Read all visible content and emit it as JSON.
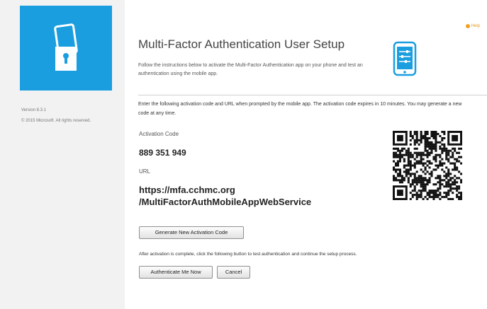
{
  "sidebar": {
    "logo_icon": "lock-phone-icon",
    "version": "Version 8.3.1",
    "copyright": "© 2015 Microsoft. All rights reserved.",
    "tile_color": "#1a9ee0"
  },
  "header": {
    "help": "Help",
    "help_icon": "help-icon",
    "title": "Multi-Factor Authentication User Setup",
    "intro": "Follow the instructions below to activate the Multi-Factor Authentication app on your phone and test an authentication using the mobile app.",
    "phone_icon": "mobile-settings-icon"
  },
  "main": {
    "instructions": "Enter the following activation code and URL when prompted by the mobile app. The activation code expires in 10 minutes. You may generate a new code at any time.",
    "activation_label": "Activation Code",
    "activation_code": "889 351 949",
    "url_label": "URL",
    "url_line1": "https://mfa.cchmc.org",
    "url_line2": "/MultiFactorAuthMobileAppWebService",
    "qr_icon": "qr-code",
    "generate_button": "Generate New Activation Code",
    "after_text": "After activation is complete, click the following button to test authentication and continue the setup process.",
    "authenticate_button": "Authenticate Me Now",
    "cancel_button": "Cancel"
  },
  "colors": {
    "accent": "#1a9ee0",
    "help": "#f0a21f"
  }
}
